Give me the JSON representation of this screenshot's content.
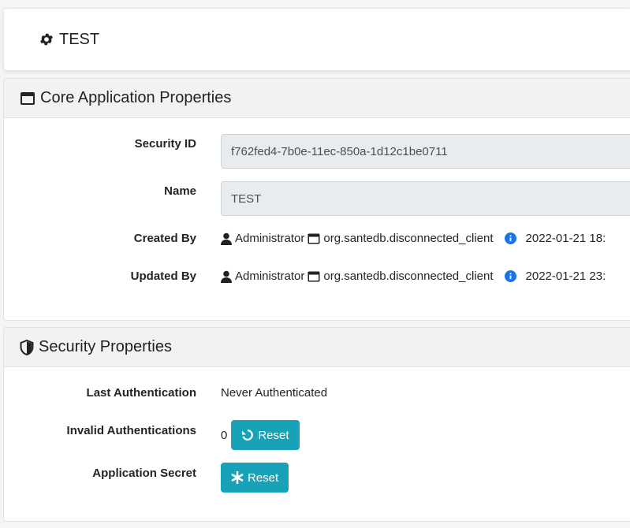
{
  "header": {
    "title": "TEST",
    "icon": "gear-icon"
  },
  "core": {
    "title": "Core Application Properties",
    "icon": "window-icon",
    "security_id": {
      "label": "Security ID",
      "value": "f762fed4-7b0e-11ec-850a-1d12c1be0711"
    },
    "name": {
      "label": "Name",
      "value": "TEST"
    },
    "created_by": {
      "label": "Created By",
      "user": "Administrator",
      "app": "org.santedb.disconnected_client",
      "time": "2022-01-21 18:"
    },
    "updated_by": {
      "label": "Updated By",
      "user": "Administrator",
      "app": "org.santedb.disconnected_client",
      "time": "2022-01-21 23:"
    }
  },
  "security": {
    "title": "Security Properties",
    "icon": "shield-icon",
    "last_auth": {
      "label": "Last Authentication",
      "value": "Never Authenticated"
    },
    "invalid_auth": {
      "label": "Invalid Authentications",
      "value": "0",
      "button": "Reset"
    },
    "app_secret": {
      "label": "Application Secret",
      "button": "Reset"
    }
  },
  "colors": {
    "accent": "#17a2b8",
    "info": "#1a73e8",
    "header_bg": "#f2f2f3"
  }
}
